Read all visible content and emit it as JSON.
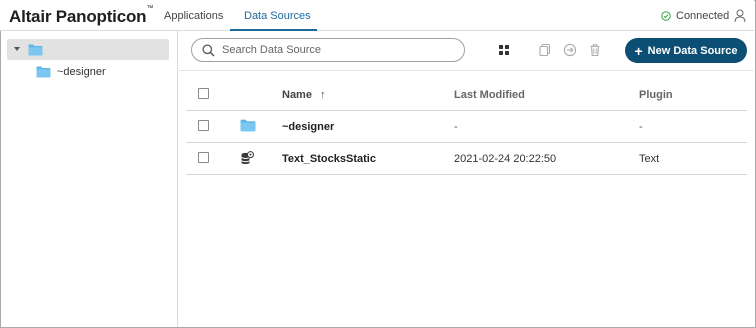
{
  "header": {
    "logo": "Altair Panopticon",
    "logo_tm": "™",
    "tabs": [
      {
        "label": "Applications",
        "active": false
      },
      {
        "label": "Data Sources",
        "active": true
      }
    ],
    "status": "Connected",
    "accent_color": "#1f6a9a",
    "status_color": "#3aa44a"
  },
  "sidebar": {
    "root_icon": "folder-icon",
    "children": [
      {
        "label": "~designer",
        "icon": "folder-icon"
      }
    ],
    "folder_color": "#5fb6e8"
  },
  "toolbar": {
    "search_placeholder": "Search Data Source",
    "new_button_label": "New Data Source",
    "new_button_color": "#0d4f74",
    "icons": [
      "grid-view-icon",
      "duplicate-icon",
      "move-icon",
      "trash-icon"
    ]
  },
  "table": {
    "columns": {
      "name": "Name",
      "modified": "Last Modified",
      "plugin": "Plugin"
    },
    "sort_indicator": "↑",
    "rows": [
      {
        "icon": "folder-icon",
        "name": "~designer",
        "modified": "-",
        "plugin": "-"
      },
      {
        "icon": "datasource-icon",
        "name": "Text_StocksStatic",
        "modified": "2021-02-24 20:22:50",
        "plugin": "Text"
      }
    ]
  }
}
